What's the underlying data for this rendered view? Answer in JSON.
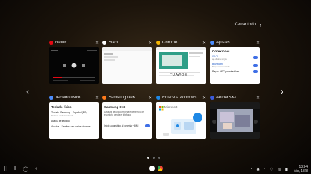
{
  "header": {
    "close_all": "Cerrar todo"
  },
  "cards": [
    {
      "title": "Netflix",
      "icon": "netflix-icon",
      "color": "#e50914"
    },
    {
      "title": "Slack",
      "icon": "slack-icon",
      "color": "#ffffff"
    },
    {
      "title": "Chrome",
      "icon": "chrome-icon",
      "color": "#f4b400"
    },
    {
      "title": "Ajustes",
      "icon": "settings-icon",
      "color": "#4c8dfc"
    },
    {
      "title": "Teclado físico",
      "icon": "keyboard-settings-icon",
      "color": "#4c8dfc"
    },
    {
      "title": "Samsung DeX",
      "icon": "dex-icon",
      "color": "#ff7a1a"
    },
    {
      "title": "Enlace a Windows",
      "icon": "link-to-windows-icon",
      "color": "#1e88e5"
    },
    {
      "title": "AetherSX2",
      "icon": "aethersx2-icon",
      "color": "#3b5bdb"
    }
  ],
  "thumbnails": {
    "ajustes": {
      "heading": "Conexiones",
      "rows": [
        {
          "label": "Wi-Fi",
          "sub": "ap.oficina.tarjeta"
        },
        {
          "label": "Bluetooth",
          "sub": "Ninguno conectado"
        },
        {
          "label": "Pagos NFC y contactless",
          "sub": ""
        }
      ]
    },
    "teclado": {
      "heading": "Teclado físico",
      "rows": [
        {
          "label": "Teclado Samsung - Español (ES)",
          "sub": "Teclado predeterminado"
        },
        {
          "label": "Atajos de teclado",
          "sub": ""
        },
        {
          "label": "Ajustes - Escritura en varias idiomas",
          "sub": ""
        }
      ]
    },
    "dex": {
      "heading": "Samsung DeX",
      "body": "Disfruta de una completa experiencia de escritorio desde el teléfono.",
      "toggle_label": "Inicio automático al conectar HDMI"
    },
    "enlace": {
      "logo_text": "Microsoft"
    },
    "chrome": {
      "tile_text": "TUAWOE"
    }
  },
  "pager": {
    "pages": 3,
    "active": 0
  },
  "taskbar": {
    "time": "13:24",
    "date": "Vie, 18/8"
  },
  "colors": {
    "toggle": "#3f6fe6"
  }
}
